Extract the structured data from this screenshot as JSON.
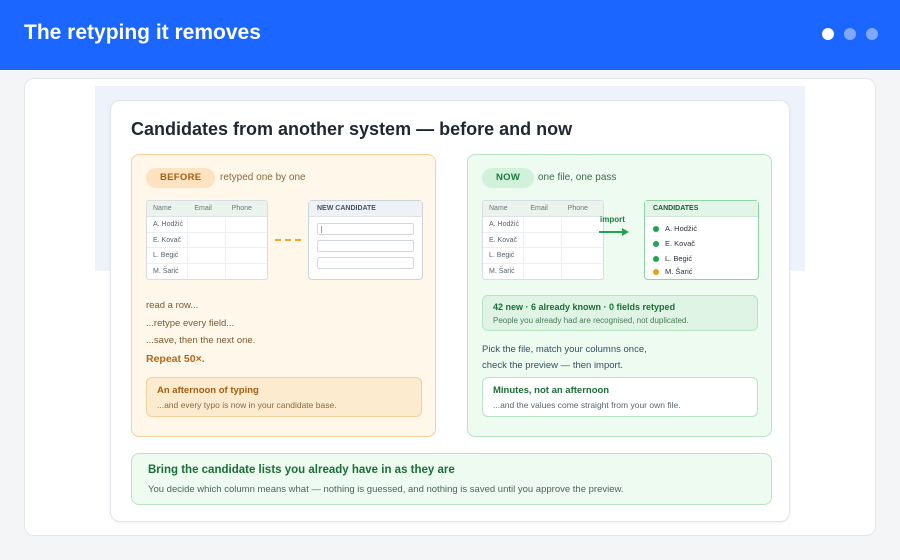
{
  "header": {
    "title": "The retyping it removes",
    "dots": 3,
    "active_dot": 0,
    "background": "#1a66ff"
  },
  "card": {
    "title": "Candidates from another system — before and now"
  },
  "before": {
    "pill": "BEFORE",
    "caption": "retyped one by one",
    "table": {
      "columns": [
        "Name",
        "Email",
        "Phone"
      ],
      "rows": [
        "A. Hodžić",
        "E. Kovač",
        "L. Begić",
        "M. Šarić"
      ]
    },
    "form": {
      "title": "NEW CANDIDATE",
      "field_count": 3
    },
    "steps": [
      "read a row...",
      "...retype every field...",
      "...save, then the next one."
    ],
    "repeat": "Repeat 50×.",
    "note": {
      "title": "An afternoon of typing",
      "text": "...and every typo is now in your candidate base."
    },
    "accent": "#f4cf9c"
  },
  "now": {
    "pill": "NOW",
    "caption": "one file, one pass",
    "table": {
      "columns": [
        "Name",
        "Email",
        "Phone"
      ],
      "rows": [
        "A. Hodžić",
        "E. Kovač",
        "L. Begić",
        "M. Šarić"
      ]
    },
    "import_label": "import",
    "candidates": {
      "title": "CANDIDATES",
      "items": [
        {
          "name": "A. Hodžić",
          "status": "new",
          "color": "#22a550"
        },
        {
          "name": "E. Kovač",
          "status": "new",
          "color": "#22a550"
        },
        {
          "name": "L. Begić",
          "status": "new",
          "color": "#22a550"
        },
        {
          "name": "M. Šarić",
          "status": "known",
          "color": "#e3a21a"
        }
      ]
    },
    "stats": {
      "title": "42 new · 6 already known · 0 fields retyped",
      "text": "People you already had are recognised, not duplicated."
    },
    "steps": [
      "Pick the file, match your columns once,",
      "check the preview — then import."
    ],
    "note": {
      "title": "Minutes, not an afternoon",
      "text": "...and the values come straight from your own file."
    },
    "accent": "#b7e4c3"
  },
  "footer": {
    "title": "Bring the candidate lists you already have in as they are",
    "text": "You decide which column means what — nothing is guessed, and nothing is saved until you approve the preview."
  }
}
